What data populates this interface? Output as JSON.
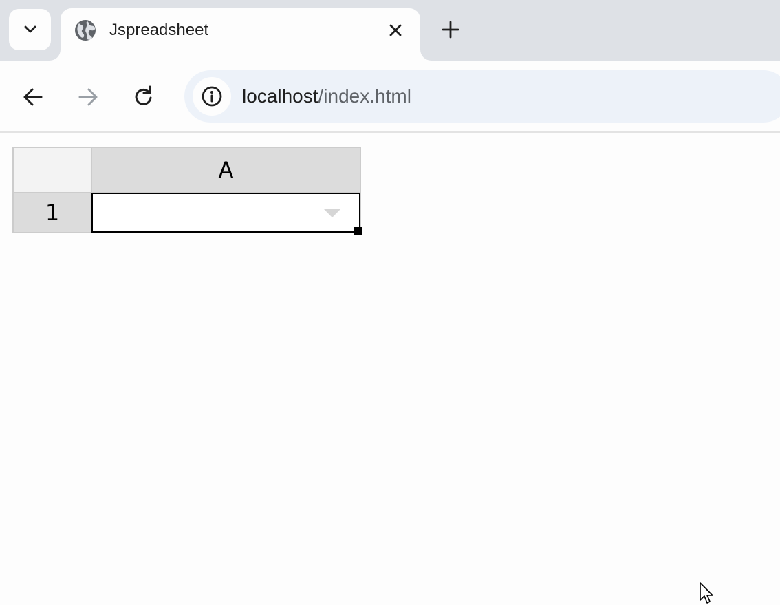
{
  "browser": {
    "tab": {
      "title": "Jspreadsheet",
      "favicon": "globe-icon"
    },
    "address_bar": {
      "host": "localhost",
      "path": "/index.html"
    },
    "colors": {
      "tabstrip": "#dee1e6",
      "omnibox": "#edf2f9",
      "page": "#fdfdfd"
    }
  },
  "spreadsheet": {
    "columns": [
      "A"
    ],
    "rows": [
      {
        "label": "1",
        "cells": [
          {
            "value": "",
            "type": "dropdown"
          }
        ]
      }
    ],
    "selected_cell": "A1",
    "colors": {
      "header": "#dcdcdc",
      "corner": "#f3f3f3",
      "grid": "#cccccc",
      "dropdown_arrow": "#d6d6d6"
    }
  }
}
